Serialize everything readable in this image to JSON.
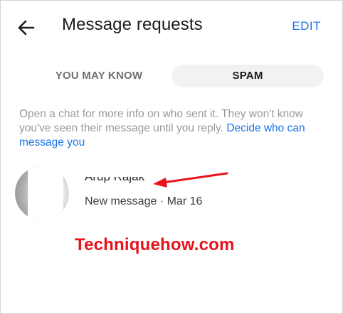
{
  "header": {
    "title": "Message requests",
    "edit_label": "EDIT"
  },
  "tabs": [
    {
      "label": "YOU MAY KNOW",
      "selected": false
    },
    {
      "label": "SPAM",
      "selected": true
    }
  ],
  "info": {
    "text": "Open a chat for more info on who sent it. They won't know you've seen their message until you reply. ",
    "link": "Decide who can message you"
  },
  "requests": [
    {
      "name": "Arup Rajak",
      "subtitle": "New message · Mar 16"
    }
  ],
  "watermark": "Techniquehow.com",
  "colors": {
    "accent": "#1a73e8",
    "annotation": "#e8121b",
    "tab_selected_bg": "#f2f2f2"
  },
  "icons": {
    "back": "arrow-left-icon",
    "annotation": "red-arrow-annotation"
  }
}
